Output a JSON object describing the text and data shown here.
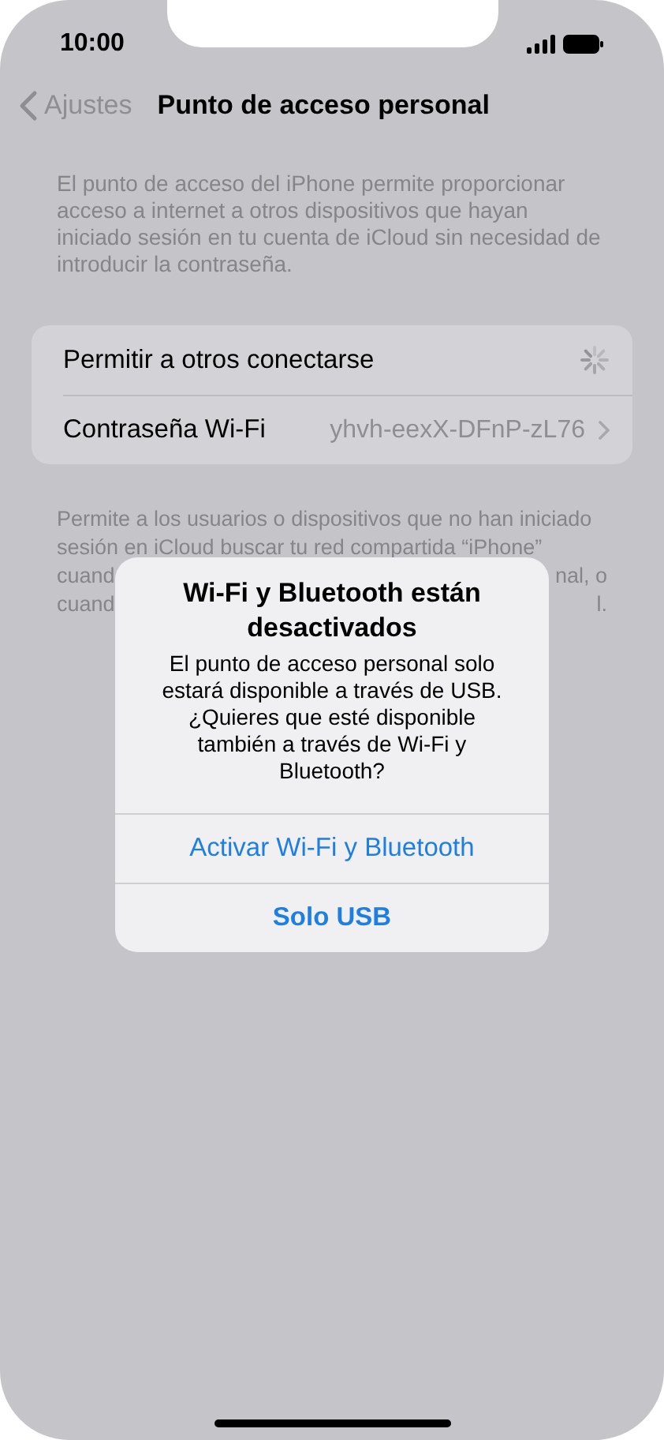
{
  "status_bar": {
    "time": "10:00"
  },
  "nav": {
    "back": "Ajustes",
    "title": "Punto de acceso personal"
  },
  "header_text": "El punto de acceso del iPhone permite proporcionar acceso a internet a otros dispositivos que hayan iniciado sesión en tu cuenta de iCloud sin necesidad de introducir la contraseña.",
  "rows": [
    {
      "kind": "spinner",
      "label": "Permitir a otros conectarse"
    },
    {
      "kind": "detail",
      "label": "Contraseña Wi-Fi",
      "value": "yhvh-eexX-DFnP-zL76"
    }
  ],
  "footer_lines": [
    {
      "left": "Permite a los usuarios o dispositivos que no han iniciado"
    },
    {
      "left": "sesión en iCloud buscar tu red compartida “iPhone”"
    },
    {
      "left": "cuand",
      "right": "nal, o"
    },
    {
      "left": "cuand",
      "right": "l."
    }
  ],
  "alert": {
    "title": "Wi-Fi y Bluetooth están desactivados",
    "message": "El punto de acceso personal solo estará disponible a través de USB. ¿Quieres que esté disponible también a través de Wi-Fi y Bluetooth?",
    "buttons": [
      {
        "label": "Activar Wi-Fi y Bluetooth",
        "kind": "default"
      },
      {
        "label": "Solo USB",
        "kind": "preferred"
      }
    ]
  }
}
